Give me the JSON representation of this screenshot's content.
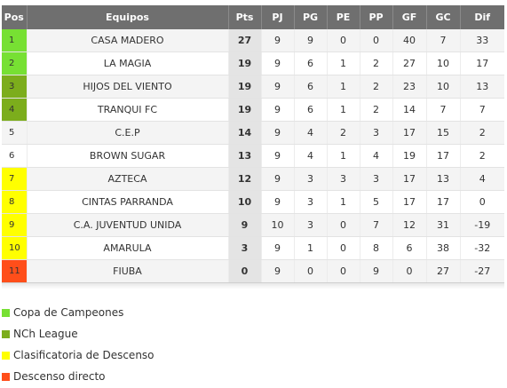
{
  "header": {
    "columns": [
      "Pos",
      "Equipos",
      "Pts",
      "PJ",
      "PG",
      "PE",
      "PP",
      "GF",
      "GC",
      "Dif"
    ]
  },
  "zone_colors": {
    "champions": "#77e033",
    "nch": "#7cad1c",
    "qualifier": "#ffff00",
    "relegation": "#ff4e1a"
  },
  "standings": [
    {
      "pos": "1",
      "zone": "champions",
      "team": "CASA MADERO",
      "pts": "27",
      "pj": "9",
      "pg": "9",
      "pe": "0",
      "pp": "0",
      "gf": "40",
      "gc": "7",
      "dif": "33"
    },
    {
      "pos": "2",
      "zone": "champions",
      "team": "LA MAGIA",
      "pts": "19",
      "pj": "9",
      "pg": "6",
      "pe": "1",
      "pp": "2",
      "gf": "27",
      "gc": "10",
      "dif": "17"
    },
    {
      "pos": "3",
      "zone": "nch",
      "team": "HIJOS DEL VIENTO",
      "pts": "19",
      "pj": "9",
      "pg": "6",
      "pe": "1",
      "pp": "2",
      "gf": "23",
      "gc": "10",
      "dif": "13"
    },
    {
      "pos": "4",
      "zone": "nch",
      "team": "TRANQUI FC",
      "pts": "19",
      "pj": "9",
      "pg": "6",
      "pe": "1",
      "pp": "2",
      "gf": "14",
      "gc": "7",
      "dif": "7"
    },
    {
      "pos": "5",
      "zone": "none",
      "team": "C.E.P",
      "pts": "14",
      "pj": "9",
      "pg": "4",
      "pe": "2",
      "pp": "3",
      "gf": "17",
      "gc": "15",
      "dif": "2"
    },
    {
      "pos": "6",
      "zone": "none",
      "team": "BROWN SUGAR",
      "pts": "13",
      "pj": "9",
      "pg": "4",
      "pe": "1",
      "pp": "4",
      "gf": "19",
      "gc": "17",
      "dif": "2"
    },
    {
      "pos": "7",
      "zone": "qualifier",
      "team": "AZTECA",
      "pts": "12",
      "pj": "9",
      "pg": "3",
      "pe": "3",
      "pp": "3",
      "gf": "17",
      "gc": "13",
      "dif": "4"
    },
    {
      "pos": "8",
      "zone": "qualifier",
      "team": "CINTAS PARRANDA",
      "pts": "10",
      "pj": "9",
      "pg": "3",
      "pe": "1",
      "pp": "5",
      "gf": "17",
      "gc": "17",
      "dif": "0"
    },
    {
      "pos": "9",
      "zone": "qualifier",
      "team": "C.A. JUVENTUD UNIDA",
      "pts": "9",
      "pj": "10",
      "pg": "3",
      "pe": "0",
      "pp": "7",
      "gf": "12",
      "gc": "31",
      "dif": "-19"
    },
    {
      "pos": "10",
      "zone": "qualifier",
      "team": "AMARULA",
      "pts": "3",
      "pj": "9",
      "pg": "1",
      "pe": "0",
      "pp": "8",
      "gf": "6",
      "gc": "38",
      "dif": "-32"
    },
    {
      "pos": "11",
      "zone": "relegation",
      "team": "FIUBA",
      "pts": "0",
      "pj": "9",
      "pg": "0",
      "pe": "0",
      "pp": "9",
      "gf": "0",
      "gc": "27",
      "dif": "-27"
    }
  ],
  "legend": [
    {
      "zone": "champions",
      "label": "Copa de Campeones"
    },
    {
      "zone": "nch",
      "label": "NCh League"
    },
    {
      "zone": "qualifier",
      "label": "Clasificatoria de Descenso"
    },
    {
      "zone": "relegation",
      "label": "Descenso directo"
    }
  ]
}
